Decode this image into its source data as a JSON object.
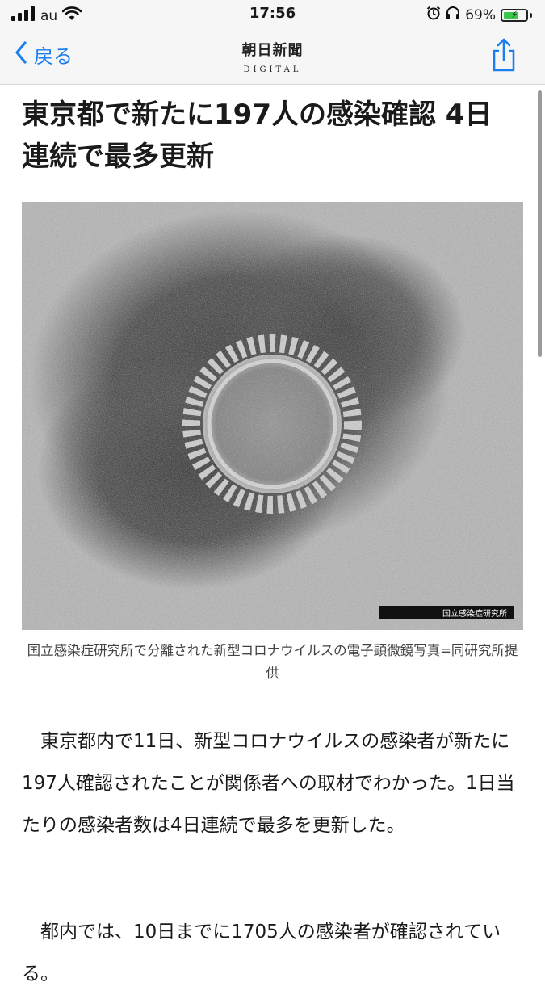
{
  "status_bar": {
    "carrier": "au",
    "time": "17:56",
    "battery_percent": "69%",
    "battery_level": 0.69
  },
  "nav": {
    "back_label": "戻る",
    "logo_main": "朝日新聞",
    "logo_sub": "DIGITAL"
  },
  "article": {
    "title": "東京都で新たに197人の感染確認 4日連続で最多更新",
    "image_credit": "国立感染症研究所",
    "caption": "国立感染症研究所で分離された新型コロナウイルスの電子顕微鏡写真=同研究所提供",
    "paragraphs": [
      "東京都内で11日、新型コロナウイルスの感染者が新たに197人確認されたことが関係者への取材でわかった。1日当たりの感染者数は4日連続で最多を更新した。",
      "都内では、10日までに1705人の感染者が確認されている。"
    ]
  },
  "icons": [
    "signal-icon",
    "wifi-icon",
    "alarm-icon",
    "headphones-icon",
    "battery-icon",
    "back-chevron-icon",
    "share-icon"
  ]
}
